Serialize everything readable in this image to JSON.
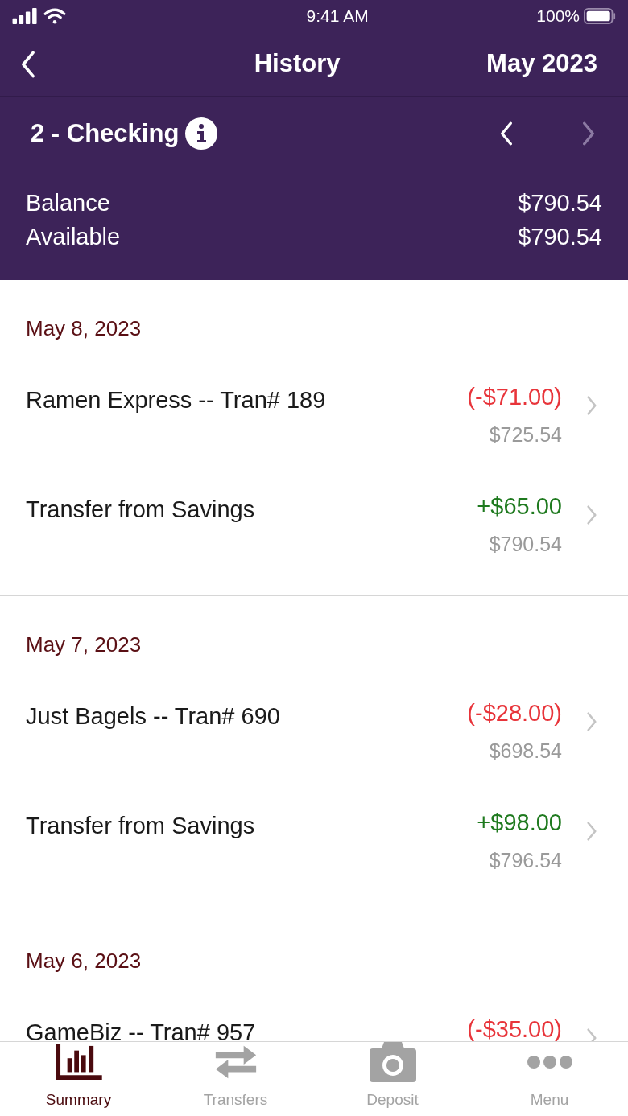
{
  "status_bar": {
    "time": "9:41 AM",
    "battery": "100%"
  },
  "nav": {
    "title": "History",
    "period": "May 2023"
  },
  "account": {
    "name": "2 - Checking",
    "prev_disabled": false,
    "next_disabled": true,
    "rows": [
      {
        "label": "Balance",
        "value": "$790.54"
      },
      {
        "label": "Available",
        "value": "$790.54"
      }
    ]
  },
  "days": [
    {
      "date": "May 8, 2023",
      "transactions": [
        {
          "title": "Ramen Express -- Tran# 189",
          "kind": "debit",
          "amount": "(-$71.00)",
          "balance": "$725.54"
        },
        {
          "title": "Transfer from Savings",
          "kind": "credit",
          "amount": "+$65.00",
          "balance": "$790.54"
        }
      ]
    },
    {
      "date": "May 7, 2023",
      "transactions": [
        {
          "title": "Just Bagels -- Tran# 690",
          "kind": "debit",
          "amount": "(-$28.00)",
          "balance": "$698.54"
        },
        {
          "title": "Transfer from Savings",
          "kind": "credit",
          "amount": "+$98.00",
          "balance": "$796.54"
        }
      ]
    },
    {
      "date": "May 6, 2023",
      "transactions": [
        {
          "title": "GameBiz -- Tran# 957",
          "kind": "debit",
          "amount": "(-$35.00)"
        }
      ]
    }
  ],
  "tabs": [
    {
      "label": "Summary",
      "kind": "summary",
      "selected": true
    },
    {
      "label": "Transfers",
      "kind": "transfers",
      "selected": false
    },
    {
      "label": "Deposit",
      "kind": "deposit",
      "selected": false
    },
    {
      "label": "Menu",
      "kind": "menu",
      "selected": false
    }
  ]
}
